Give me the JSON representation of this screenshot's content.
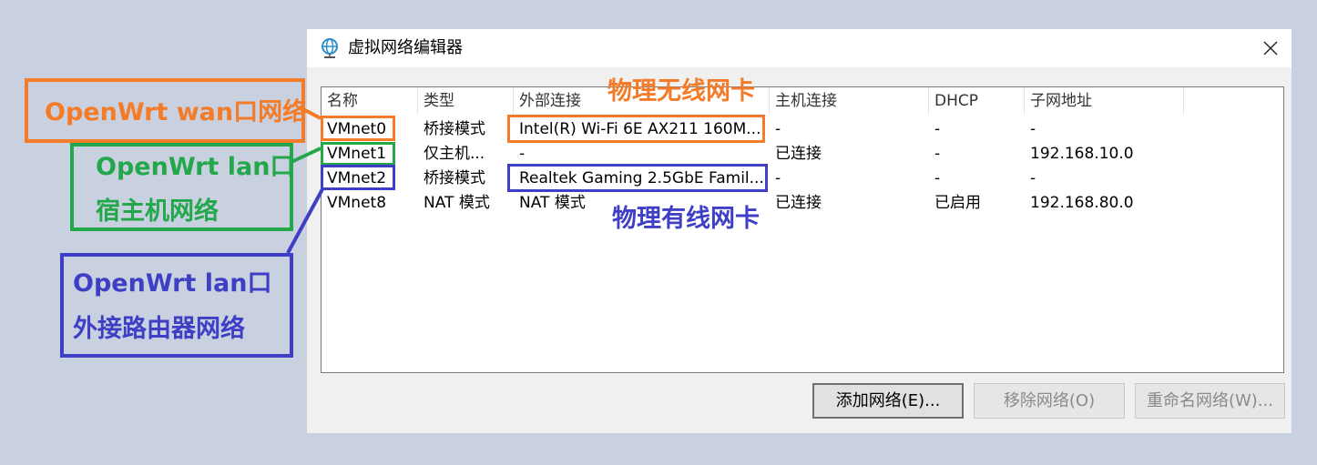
{
  "dialog": {
    "title": "虚拟网络编辑器",
    "icon": "globe-network-icon",
    "close_icon": "close-icon"
  },
  "table": {
    "headers": [
      "名称",
      "类型",
      "外部连接",
      "主机连接",
      "DHCP",
      "子网地址"
    ],
    "rows": [
      [
        "VMnet0",
        "桥接模式",
        "Intel(R) Wi-Fi 6E AX211 160M...",
        "-",
        "-",
        "-"
      ],
      [
        "VMnet1",
        "仅主机...",
        "-",
        "已连接",
        "-",
        "192.168.10.0"
      ],
      [
        "VMnet2",
        "桥接模式",
        "Realtek Gaming 2.5GbE Famil...",
        "-",
        "-",
        "-"
      ],
      [
        "VMnet8",
        "NAT 模式",
        "NAT 模式",
        "已连接",
        "已启用",
        "192.168.80.0"
      ]
    ]
  },
  "buttons": {
    "add": "添加网络(E)...",
    "remove": "移除网络(O)",
    "rename": "重命名网络(W)..."
  },
  "annotations": {
    "wan": "OpenWrt wan口网络",
    "lan_host_line1": "OpenWrt lan口",
    "lan_host_line2": "宿主机网络",
    "lan_router_line1": "OpenWrt lan口",
    "lan_router_line2": "外接路由器网络",
    "wireless": "物理无线网卡",
    "wired": "物理有线网卡"
  },
  "colors": {
    "orange": "#f47b27",
    "green": "#22a84a",
    "blue": "#3f3fc6",
    "background": "#c9d1e0"
  }
}
